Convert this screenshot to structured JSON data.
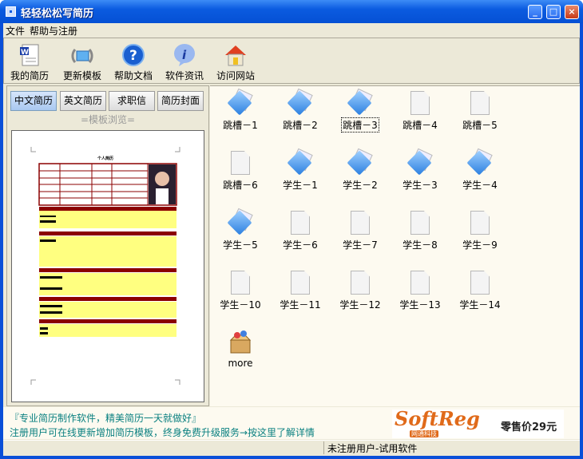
{
  "window": {
    "title": "轻轻松松写简历",
    "minimize": "_",
    "maximize": "□",
    "close": "×"
  },
  "menu": [
    "文件",
    "帮助与注册"
  ],
  "toolbar": [
    {
      "label": "我的简历",
      "icon": "word-doc-icon"
    },
    {
      "label": "更新模板",
      "icon": "refresh-icon"
    },
    {
      "label": "帮助文档",
      "icon": "help-icon"
    },
    {
      "label": "软件资讯",
      "icon": "info-icon"
    },
    {
      "label": "访问网站",
      "icon": "home-icon"
    }
  ],
  "tabs": [
    {
      "label": "中文简历",
      "active": true
    },
    {
      "label": "英文简历"
    },
    {
      "label": "求职信"
    },
    {
      "label": "简历封面"
    }
  ],
  "browse_label": "=模板浏览=",
  "preview": {
    "heading": "个人简历"
  },
  "templates": [
    {
      "label": "跳槽－1",
      "type": "blue"
    },
    {
      "label": "跳槽－2",
      "type": "blue"
    },
    {
      "label": "跳槽－3",
      "type": "blue",
      "selected": true
    },
    {
      "label": "跳槽－4",
      "type": "blank"
    },
    {
      "label": "跳槽－5",
      "type": "blank"
    },
    {
      "label": "跳槽－6",
      "type": "blank"
    },
    {
      "label": "学生－1",
      "type": "blue"
    },
    {
      "label": "学生－2",
      "type": "blue"
    },
    {
      "label": "学生－3",
      "type": "blue"
    },
    {
      "label": "学生－4",
      "type": "blue"
    },
    {
      "label": "学生－5",
      "type": "blue"
    },
    {
      "label": "学生－6",
      "type": "blank"
    },
    {
      "label": "学生－7",
      "type": "blank"
    },
    {
      "label": "学生－8",
      "type": "blank"
    },
    {
      "label": "学生－9",
      "type": "blank"
    },
    {
      "label": "学生－10",
      "type": "blank"
    },
    {
      "label": "学生－11",
      "type": "blank"
    },
    {
      "label": "学生－12",
      "type": "blank"
    },
    {
      "label": "学生－13",
      "type": "blank"
    },
    {
      "label": "学生－14",
      "type": "blank"
    },
    {
      "label": "more",
      "type": "box"
    }
  ],
  "bottom": {
    "line1": "『专业简历制作软件，精美简历一天就做好』",
    "line2": "注册用户可在线更新增加简历模板，终身免费升级服务→按这里了解详情",
    "ad_logo": "SoftReg",
    "ad_sub": "网通科技",
    "ad_price": "零售价29元"
  },
  "status": "未注册用户-试用软件",
  "colors": {
    "accent": "#0a4fd8",
    "resume_red": "#8b0000",
    "promo_text": "#0a8080"
  }
}
